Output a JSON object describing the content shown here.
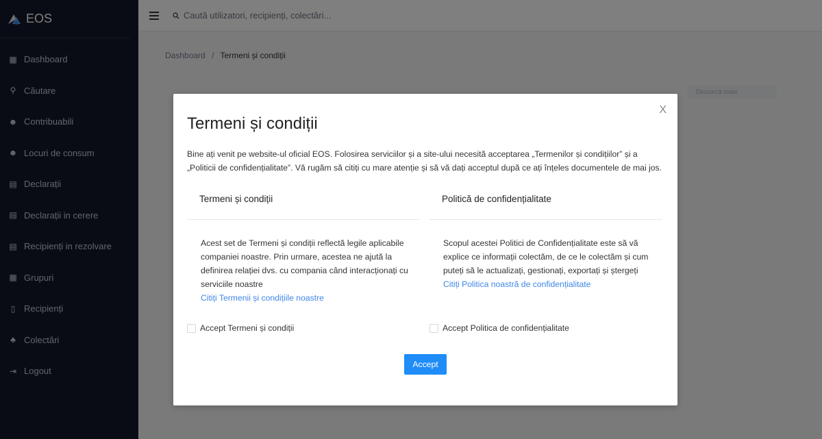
{
  "app": {
    "name": "EOS"
  },
  "sidebar": {
    "items": [
      {
        "label": "Dashboard",
        "icon": "dashboard-grid-icon"
      },
      {
        "label": "Căutare",
        "icon": "search-icon"
      },
      {
        "label": "Contribuabili",
        "icon": "users-icon"
      },
      {
        "label": "Locuri de consum",
        "icon": "users-icon"
      },
      {
        "label": "Declarații",
        "icon": "document-icon"
      },
      {
        "label": "Declarații in cerere",
        "icon": "document-icon"
      },
      {
        "label": "Recipienți in rezolvare",
        "icon": "document-icon"
      },
      {
        "label": "Grupuri",
        "icon": "groups-icon"
      },
      {
        "label": "Recipienți",
        "icon": "bin-icon"
      },
      {
        "label": "Colectări",
        "icon": "collection-icon"
      },
      {
        "label": "Logout",
        "icon": "logout-icon"
      }
    ]
  },
  "topbar": {
    "search_placeholder": "Caută utilizatori, recipienți, colectări..."
  },
  "breadcrumb": {
    "home": "Dashboard",
    "separator": "/",
    "current": "Termeni și condiții"
  },
  "background_button": {
    "label": "Descarcă toate"
  },
  "modal": {
    "title": "Termeni și condiții",
    "close": "X",
    "intro": "Bine ați venit pe website-ul oficial EOS. Folosirea serviciilor și a site-ului necesită acceptarea „Termenilor și condițiilor” și a „Politicii de confidențialitate”. Vă rugăm să citiți cu mare atenție și să vă dați acceptul după ce ați înțeles documentele de mai jos.",
    "terms": {
      "heading": "Termeni și condiții",
      "body": "Acest set de Termeni și condiții reflectă legile aplicabile companiei noastre. Prin urmare, acestea ne ajută la definirea relației dvs. cu compania când interacționați cu serviciile noastre",
      "link": "Citiți Termenii și condițiile noastre",
      "checkbox_label": "Accept Termeni și condiții"
    },
    "privacy": {
      "heading": "Politică de confidențialitate",
      "body": "Scopul acestei Politici de Confidențialitate este să vă explice ce informații colectăm, de ce le colectăm și cum puteți să le actualizați, gestionați, exportați și ștergeți",
      "link": "Citiți Politica noastră de confidențialitate",
      "checkbox_label": "Accept Politica de confidențialitate"
    },
    "accept_label": "Accept"
  },
  "colors": {
    "sidebar_bg": "#15192b",
    "accent": "#1f8cf8",
    "link": "#3f86e6"
  }
}
